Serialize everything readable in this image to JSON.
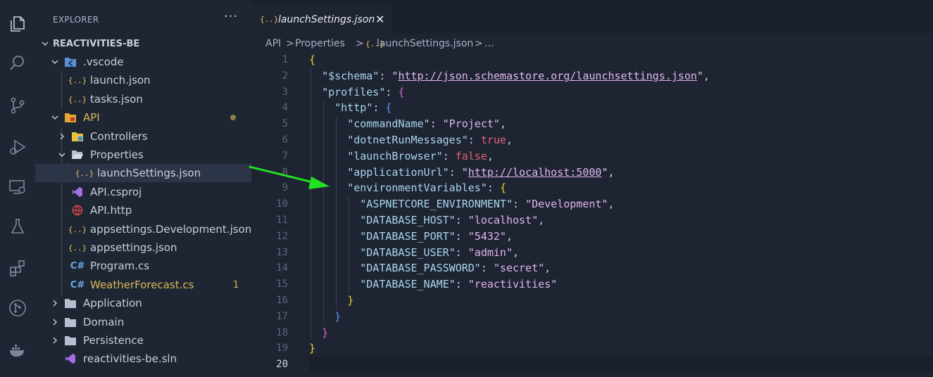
{
  "activity_bar": {
    "icons": [
      "explorer-icon",
      "search-icon",
      "source-control-icon",
      "run-debug-icon",
      "remote-explorer-icon",
      "testing-icon",
      "extensions-icon",
      "git-graph-icon",
      "docker-icon"
    ]
  },
  "sidebar": {
    "title": "EXPLORER",
    "more": "···",
    "project": "REACTIVITIES-BE",
    "items": [
      {
        "label": ".vscode"
      },
      {
        "label": "launch.json"
      },
      {
        "label": "tasks.json"
      },
      {
        "label": "API"
      },
      {
        "label": "Controllers"
      },
      {
        "label": "Properties"
      },
      {
        "label": "launchSettings.json"
      },
      {
        "label": "API.csproj"
      },
      {
        "label": "API.http"
      },
      {
        "label": "appsettings.Development.json"
      },
      {
        "label": "appsettings.json"
      },
      {
        "label": "Program.cs"
      },
      {
        "label": "WeatherForecast.cs",
        "badge": "1"
      },
      {
        "label": "Application"
      },
      {
        "label": "Domain"
      },
      {
        "label": "Persistence"
      },
      {
        "label": "reactivities-be.sln"
      }
    ],
    "json_icon": "{..}",
    "cs_icon": "C#"
  },
  "editor": {
    "tab": {
      "icon": "{..}",
      "label": "launchSettings.json",
      "close": "✕"
    },
    "breadcrumb": {
      "parts": [
        "API",
        ">",
        "Properties",
        ">",
        "{..}",
        "launchSettings.json",
        ">",
        "..."
      ]
    },
    "line_numbers": [
      "1",
      "2",
      "3",
      "4",
      "5",
      "6",
      "7",
      "8",
      "9",
      "10",
      "11",
      "12",
      "13",
      "14",
      "15",
      "16",
      "17",
      "18",
      "19",
      "20"
    ],
    "active_line": "20"
  },
  "code": {
    "schema_key": "\"$schema\"",
    "schema_url": "http://json.schemastore.org/launchsettings.json",
    "profiles_key": "\"profiles\"",
    "http_key": "\"http\"",
    "commandName_key": "\"commandName\"",
    "commandName_val": "\"Project\"",
    "dotnetRunMessages_key": "\"dotnetRunMessages\"",
    "dotnetRunMessages_val": "true",
    "launchBrowser_key": "\"launchBrowser\"",
    "launchBrowser_val": "false",
    "applicationUrl_key": "\"applicationUrl\"",
    "applicationUrl_val": "http://localhost:5000",
    "environmentVariables_key": "\"environmentVariables\"",
    "env": [
      {
        "key": "\"ASPNETCORE_ENVIRONMENT\"",
        "val": "\"Development\"",
        "comma": ","
      },
      {
        "key": "\"DATABASE_HOST\"",
        "val": "\"localhost\"",
        "comma": ","
      },
      {
        "key": "\"DATABASE_PORT\"",
        "val": "\"5432\"",
        "comma": ","
      },
      {
        "key": "\"DATABASE_USER\"",
        "val": "\"admin\"",
        "comma": ","
      },
      {
        "key": "\"DATABASE_PASSWORD\"",
        "val": "\"secret\"",
        "comma": ","
      },
      {
        "key": "\"DATABASE_NAME\"",
        "val": "\"reactivities\"",
        "comma": ""
      }
    ]
  },
  "colors": {
    "arrow": "#22e022",
    "bracket_1": "#f2d02f",
    "bracket_2": "#d36ad6",
    "bracket_3": "#5a9cf0"
  }
}
